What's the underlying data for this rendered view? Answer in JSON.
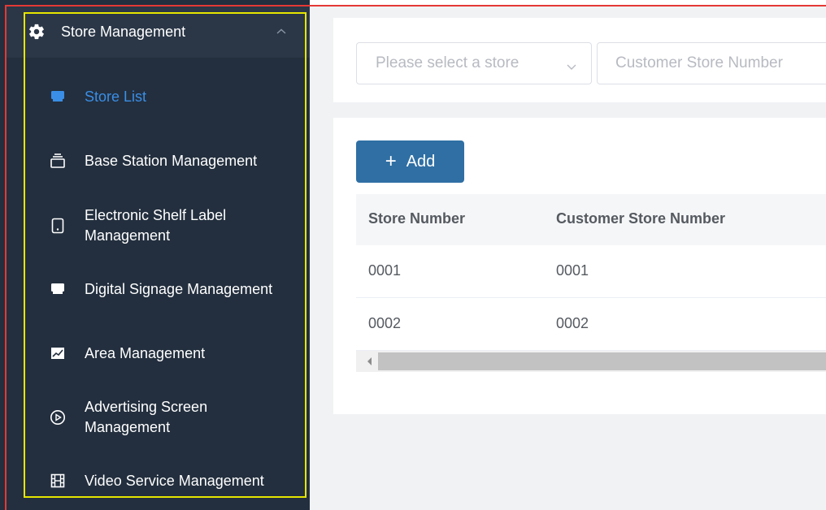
{
  "sidebar": {
    "submenu_title": "Store Management",
    "items": [
      {
        "label": "Store List",
        "icon": "store-icon",
        "active": true
      },
      {
        "label": "Base Station Management",
        "icon": "base-station-icon",
        "active": false
      },
      {
        "label": "Electronic Shelf Label Management",
        "icon": "tablet-icon",
        "active": false
      },
      {
        "label": "Digital Signage Management",
        "icon": "signage-icon",
        "active": false
      },
      {
        "label": "Area Management",
        "icon": "chart-icon",
        "active": false
      },
      {
        "label": "Advertising Screen Management",
        "icon": "play-circle-icon",
        "active": false
      },
      {
        "label": "Video Service Management",
        "icon": "film-icon",
        "active": false
      }
    ]
  },
  "filters": {
    "store_select_placeholder": "Please select a store",
    "customer_store_number_placeholder": "Customer Store Number"
  },
  "toolbar": {
    "add_label": "Add"
  },
  "table": {
    "columns": [
      "Store Number",
      "Customer Store Number"
    ],
    "rows": [
      [
        "0001",
        "0001"
      ],
      [
        "0002",
        "0002"
      ]
    ]
  },
  "colors": {
    "sidebar_bg": "#232f3e",
    "active_accent": "#3a8ee6",
    "add_button": "#2f6fa4"
  }
}
